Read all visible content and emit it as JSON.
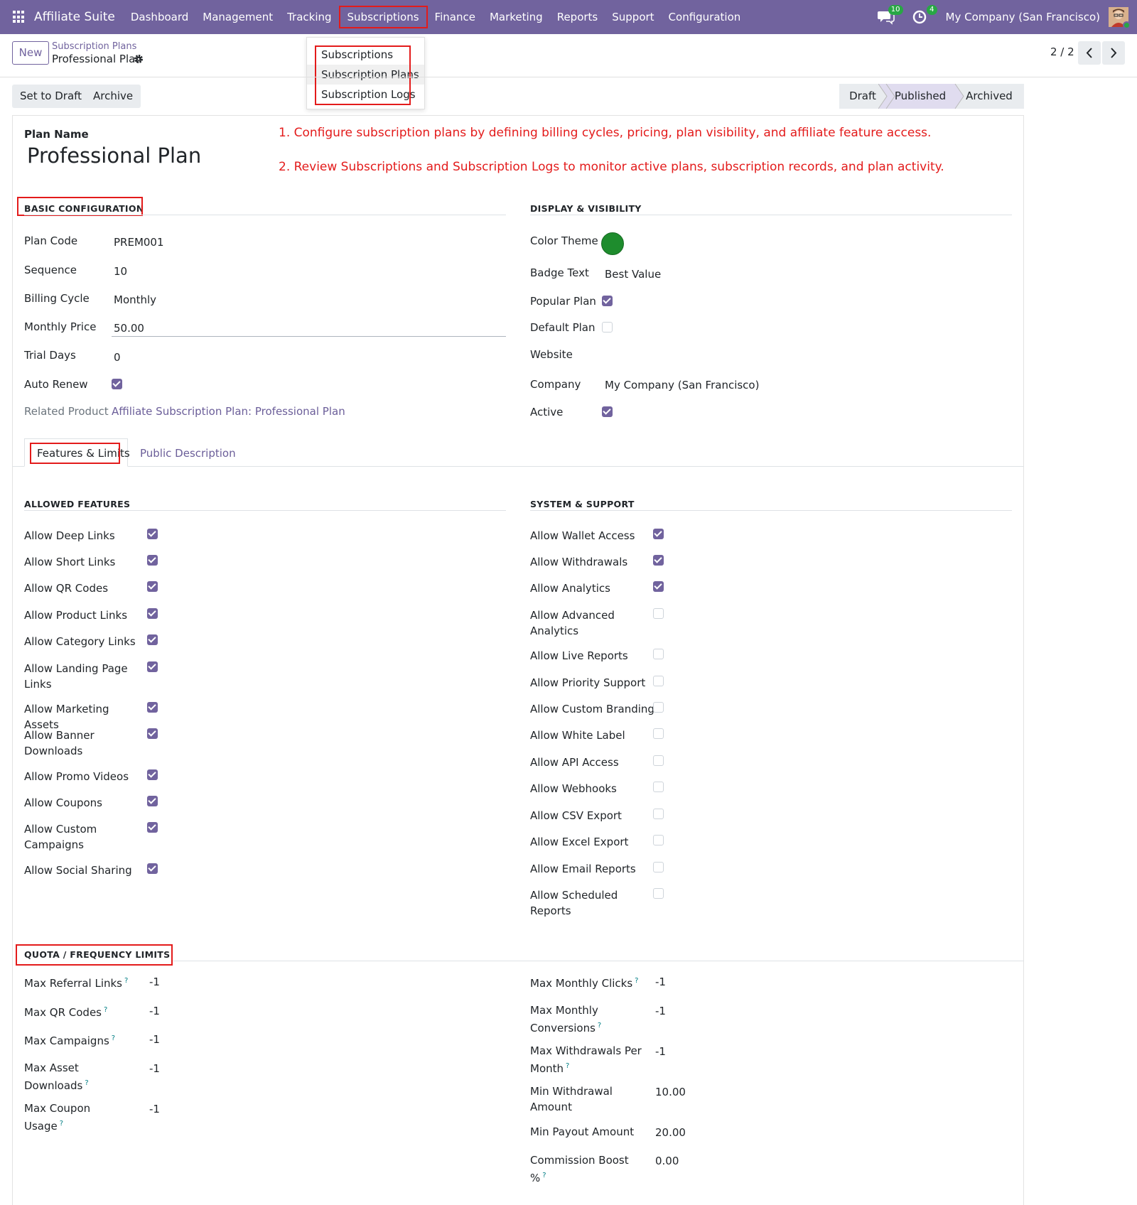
{
  "navbar": {
    "brand": "Affiliate Suite",
    "menu": [
      "Dashboard",
      "Management",
      "Tracking",
      "Subscriptions",
      "Finance",
      "Marketing",
      "Reports",
      "Support",
      "Configuration"
    ],
    "messages_badge": "10",
    "activities_badge": "4",
    "company": "My Company (San Francisco)"
  },
  "dropdown": {
    "items": [
      "Subscriptions",
      "Subscription Plans",
      "Subscription Logs"
    ]
  },
  "control_panel": {
    "new_label": "New",
    "breadcrumb_parent": "Subscription Plans",
    "breadcrumb_current": "Professional Plan",
    "pager": "2 / 2"
  },
  "statusbar": {
    "set_to_draft": "Set to Draft",
    "archive": "Archive",
    "stages": [
      "Draft",
      "Published",
      "Archived"
    ],
    "active_stage": "Published"
  },
  "form": {
    "plan_name_label": "Plan Name",
    "plan_name": "Professional Plan",
    "annotations": [
      "1. Configure subscription plans by defining billing cycles, pricing, plan visibility, and affiliate feature access.",
      "2. Review Subscriptions and Subscription Logs to monitor active plans, subscription records, and plan activity."
    ],
    "basic_title": "BASIC CONFIGURATION",
    "basic": {
      "plan_code_label": "Plan Code",
      "plan_code": "PREM001",
      "sequence_label": "Sequence",
      "sequence": "10",
      "billing_cycle_label": "Billing Cycle",
      "billing_cycle": "Monthly",
      "monthly_price_label": "Monthly Price",
      "monthly_price": "50.00",
      "trial_days_label": "Trial Days",
      "trial_days": "0",
      "auto_renew_label": "Auto Renew",
      "auto_renew": true,
      "related_product_label": "Related Product",
      "related_product": "Affiliate Subscription Plan: Professional Plan"
    },
    "display_title": "DISPLAY & VISIBILITY",
    "display": {
      "color_theme_label": "Color Theme",
      "color_theme": "#1e8c2d",
      "badge_text_label": "Badge Text",
      "badge_text": "Best Value",
      "popular_plan_label": "Popular Plan",
      "popular_plan": true,
      "default_plan_label": "Default Plan",
      "default_plan": false,
      "website_label": "Website",
      "company_label": "Company",
      "company": "My Company (San Francisco)",
      "active_label": "Active",
      "active": true
    },
    "tabs": [
      "Features & Limits",
      "Public Description"
    ],
    "allowed_title": "ALLOWED FEATURES",
    "allowed": [
      {
        "label": "Allow Deep Links",
        "on": true
      },
      {
        "label": "Allow Short Links",
        "on": true
      },
      {
        "label": "Allow QR Codes",
        "on": true
      },
      {
        "label": "Allow Product Links",
        "on": true
      },
      {
        "label": "Allow Category Links",
        "on": true
      },
      {
        "label": "Allow Landing Page Links",
        "on": true
      },
      {
        "label": "Allow Marketing Assets",
        "on": true
      },
      {
        "label": "Allow Banner Downloads",
        "on": true
      },
      {
        "label": "Allow Promo Videos",
        "on": true
      },
      {
        "label": "Allow Coupons",
        "on": true
      },
      {
        "label": "Allow Custom Campaigns",
        "on": true
      },
      {
        "label": "Allow Social Sharing",
        "on": true
      }
    ],
    "system_title": "SYSTEM & SUPPORT",
    "system": [
      {
        "label": "Allow Wallet Access",
        "on": true
      },
      {
        "label": "Allow Withdrawals",
        "on": true
      },
      {
        "label": "Allow Analytics",
        "on": true
      },
      {
        "label": "Allow Advanced Analytics",
        "on": false
      },
      {
        "label": "Allow Live Reports",
        "on": false
      },
      {
        "label": "Allow Priority Support",
        "on": false
      },
      {
        "label": "Allow Custom Branding",
        "on": false
      },
      {
        "label": "Allow White Label",
        "on": false
      },
      {
        "label": "Allow API Access",
        "on": false
      },
      {
        "label": "Allow Webhooks",
        "on": false
      },
      {
        "label": "Allow CSV Export",
        "on": false
      },
      {
        "label": "Allow Excel Export",
        "on": false
      },
      {
        "label": "Allow Email Reports",
        "on": false
      },
      {
        "label": "Allow Scheduled Reports",
        "on": false
      }
    ],
    "quota_title": "QUOTA / FREQUENCY LIMITS",
    "quota_left": [
      {
        "label": "Max Referral Links",
        "value": "-1"
      },
      {
        "label": "Max QR Codes",
        "value": "-1"
      },
      {
        "label": "Max Campaigns",
        "value": "-1"
      },
      {
        "label": "Max Asset Downloads",
        "value": "-1"
      },
      {
        "label": "Max Coupon Usage",
        "value": "-1"
      }
    ],
    "quota_right": [
      {
        "label": "Max Monthly Clicks",
        "value": "-1"
      },
      {
        "label": "Max Monthly Conversions",
        "value": "-1"
      },
      {
        "label": "Max Withdrawals Per Month",
        "value": "-1"
      },
      {
        "label": "Min Withdrawal Amount",
        "value": "10.00"
      },
      {
        "label": "Min Payout Amount",
        "value": "20.00"
      },
      {
        "label": "Commission Boost %",
        "value": "0.00"
      }
    ],
    "help_mark": "?"
  }
}
